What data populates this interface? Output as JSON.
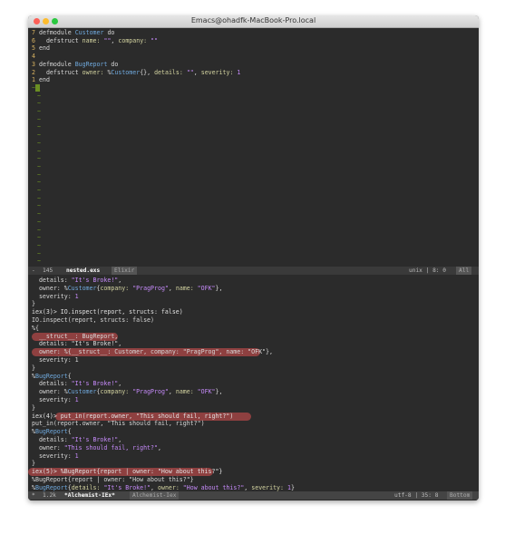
{
  "window": {
    "title": "Emacs@ohadfk-MacBook-Pro.local"
  },
  "editor": {
    "lines": [
      {
        "num": "7",
        "parts": [
          [
            "kw",
            "defmodule "
          ],
          [
            "mod",
            "Customer"
          ],
          [
            "kw",
            " do"
          ]
        ]
      },
      {
        "num": "6",
        "parts": [
          [
            "kw",
            "  defstruct "
          ],
          [
            "atom",
            "name:"
          ],
          [
            "str",
            " \"\""
          ],
          [
            "kw",
            ", "
          ],
          [
            "atom",
            "company:"
          ],
          [
            "str",
            " \"\""
          ]
        ]
      },
      {
        "num": "5",
        "parts": [
          [
            "kw",
            "end"
          ]
        ]
      },
      {
        "num": "4",
        "parts": []
      },
      {
        "num": "3",
        "parts": [
          [
            "kw",
            "defmodule "
          ],
          [
            "mod",
            "BugReport"
          ],
          [
            "kw",
            " do"
          ]
        ]
      },
      {
        "num": "2",
        "parts": [
          [
            "kw",
            "  defstruct "
          ],
          [
            "atom",
            "owner:"
          ],
          [
            "kw",
            " %"
          ],
          [
            "mod",
            "Customer"
          ],
          [
            "kw",
            "{}, "
          ],
          [
            "atom",
            "details:"
          ],
          [
            "str",
            " \"\""
          ],
          [
            "kw",
            ", "
          ],
          [
            "atom",
            "severity:"
          ],
          [
            "num",
            " 1"
          ]
        ]
      },
      {
        "num": "1",
        "parts": [
          [
            "kw",
            "end"
          ]
        ]
      }
    ],
    "tilde_char": "~",
    "tilde_count": 27
  },
  "modeline_top": {
    "marker": "-",
    "size": "145",
    "buffer": "nested.exs",
    "mode": "Elixir",
    "position": "unix | 8: 0",
    "scroll": "All"
  },
  "repl": {
    "lines": [
      [
        [
          "kw",
          "  details: "
        ],
        [
          "str",
          "\"It's Broke!\""
        ],
        [
          "kw",
          ","
        ]
      ],
      [
        [
          "kw",
          "  owner: %"
        ],
        [
          "mod",
          "Customer"
        ],
        [
          "kw",
          "{"
        ],
        [
          "atom",
          "company:"
        ],
        [
          "str",
          " \"PragProg\""
        ],
        [
          "kw",
          ", "
        ],
        [
          "atom",
          "name:"
        ],
        [
          "str",
          " \"OFK\""
        ],
        [
          "kw",
          "},"
        ]
      ],
      [
        [
          "kw",
          "  severity: "
        ],
        [
          "num",
          "1"
        ]
      ],
      [
        [
          "kw",
          "}"
        ]
      ],
      [
        [
          "prompt",
          "iex(3)> IO.inspect(report, structs: false)"
        ]
      ],
      [
        [
          "kw",
          "IO.inspect(report, structs: false)"
        ]
      ],
      [
        [
          "kw",
          "%{"
        ]
      ],
      [
        [
          "kw",
          "  __struct__: BugReport,"
        ]
      ],
      [
        [
          "kw",
          "  details: \"It's Broke!\","
        ]
      ],
      [
        [
          "kw",
          "  owner: %{__struct__: Customer, company: \"PragProg\", name: \"OFK\"},"
        ]
      ],
      [
        [
          "kw",
          "  severity: 1"
        ]
      ],
      [
        [
          "kw",
          "}"
        ]
      ],
      [
        [
          "kw",
          "%"
        ],
        [
          "mod",
          "BugReport"
        ],
        [
          "kw",
          "{"
        ]
      ],
      [
        [
          "kw",
          "  details: "
        ],
        [
          "str",
          "\"It's Broke!\""
        ],
        [
          "kw",
          ","
        ]
      ],
      [
        [
          "kw",
          "  owner: %"
        ],
        [
          "mod",
          "Customer"
        ],
        [
          "kw",
          "{"
        ],
        [
          "atom",
          "company:"
        ],
        [
          "str",
          " \"PragProg\""
        ],
        [
          "kw",
          ", "
        ],
        [
          "atom",
          "name:"
        ],
        [
          "str",
          " \"OFK\""
        ],
        [
          "kw",
          "},"
        ]
      ],
      [
        [
          "kw",
          "  severity: "
        ],
        [
          "num",
          "1"
        ]
      ],
      [
        [
          "kw",
          "}"
        ]
      ],
      [
        [
          "prompt",
          "iex(4)> put_in(report.owner, \"This should fail, right?\")"
        ]
      ],
      [
        [
          "kw",
          "put_in(report.owner, \"This should fail, right?\")"
        ]
      ],
      [
        [
          "kw",
          "%"
        ],
        [
          "mod",
          "BugReport"
        ],
        [
          "kw",
          "{"
        ]
      ],
      [
        [
          "kw",
          "  details: "
        ],
        [
          "str",
          "\"It's Broke!\""
        ],
        [
          "kw",
          ","
        ]
      ],
      [
        [
          "kw",
          "  owner: "
        ],
        [
          "str",
          "\"This should fail, right?\""
        ],
        [
          "kw",
          ","
        ]
      ],
      [
        [
          "kw",
          "  severity: "
        ],
        [
          "num",
          "1"
        ]
      ],
      [
        [
          "kw",
          "}"
        ]
      ],
      [
        [
          "prompt",
          "iex(5)> %BugReport{report | owner: \"How about this?\"}"
        ]
      ],
      [
        [
          "kw",
          "%BugReport{report | owner: \"How about this?\"}"
        ]
      ],
      [
        [
          "kw",
          "%"
        ],
        [
          "mod",
          "BugReport"
        ],
        [
          "kw",
          "{"
        ],
        [
          "atom",
          "details:"
        ],
        [
          "str",
          " \"It's Broke!\""
        ],
        [
          "kw",
          ", "
        ],
        [
          "atom",
          "owner:"
        ],
        [
          "str",
          " \"How about this?\""
        ],
        [
          "kw",
          ", "
        ],
        [
          "atom",
          "severity:"
        ],
        [
          "num",
          " 1"
        ],
        [
          "kw",
          "}"
        ]
      ],
      [
        [
          "prompt",
          "iex(6)> "
        ]
      ]
    ]
  },
  "modeline_bottom": {
    "marker": "*",
    "size": "1.2k",
    "buffer": "*Alchemist-IEx*",
    "mode": "Alchemist-Iex",
    "position": "utf-8 | 35: 8",
    "scroll": "Bottom"
  },
  "colors": {
    "background": "#2b2b2b",
    "highlight": "#b04848",
    "line_number": "#d9b260",
    "tilde": "#6b8e23",
    "module": "#6fa8dc",
    "string": "#c58af9"
  }
}
